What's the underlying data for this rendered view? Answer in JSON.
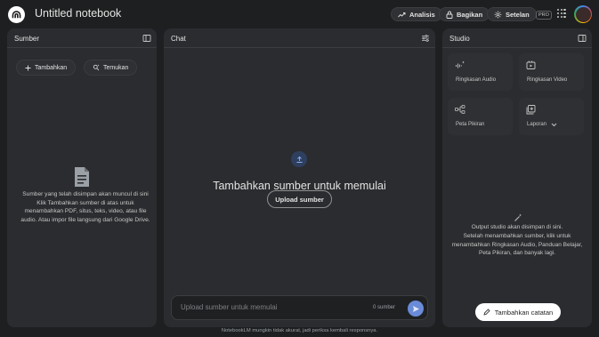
{
  "app": {
    "notebook_title": "Untitled notebook"
  },
  "header": {
    "analysis_label": "Analisis",
    "share_label": "Bagikan",
    "settings_label": "Setelan",
    "pro_badge": "PRO"
  },
  "sources": {
    "title": "Sumber",
    "add_label": "Tambahkan",
    "discover_label": "Temukan",
    "empty_text": "Sumber yang telah disimpan akan muncul di sini\nKlik Tambahkan sumber di atas untuk menambahkan PDF, situs, teks, video, atau file audio. Atau impor file langsung dari Google Drive."
  },
  "chat": {
    "title": "Chat",
    "empty_title": "Tambahkan sumber untuk memulai",
    "upload_label": "Upload sumber",
    "input_placeholder": "Upload sumber untuk memulai",
    "source_count": "0 sumber"
  },
  "studio": {
    "title": "Studio",
    "tiles": [
      {
        "label": "Ringkasan Audio",
        "icon": "audio-sparkle-icon"
      },
      {
        "label": "Ringkasan Video",
        "icon": "video-icon"
      },
      {
        "label": "Peta Pikiran",
        "icon": "mind-map-icon"
      },
      {
        "label": "Laporan",
        "icon": "report-icon"
      }
    ],
    "empty_text": "Output studio akan disimpan di sini.\nSetelah menambahkan sumber, klik untuk menambahkan Ringkasan Audio, Panduan Belajar, Peta Pikiran, dan banyak lagi.",
    "add_note_label": "Tambahkan catatan"
  },
  "footer": {
    "disclaimer": "NotebookLM mungkin tidak akurat, jadi periksa kembali responsnya."
  },
  "colors": {
    "background": "#1e1f20",
    "panel": "#2b2c2f",
    "send_button": "#6a8bd8"
  }
}
